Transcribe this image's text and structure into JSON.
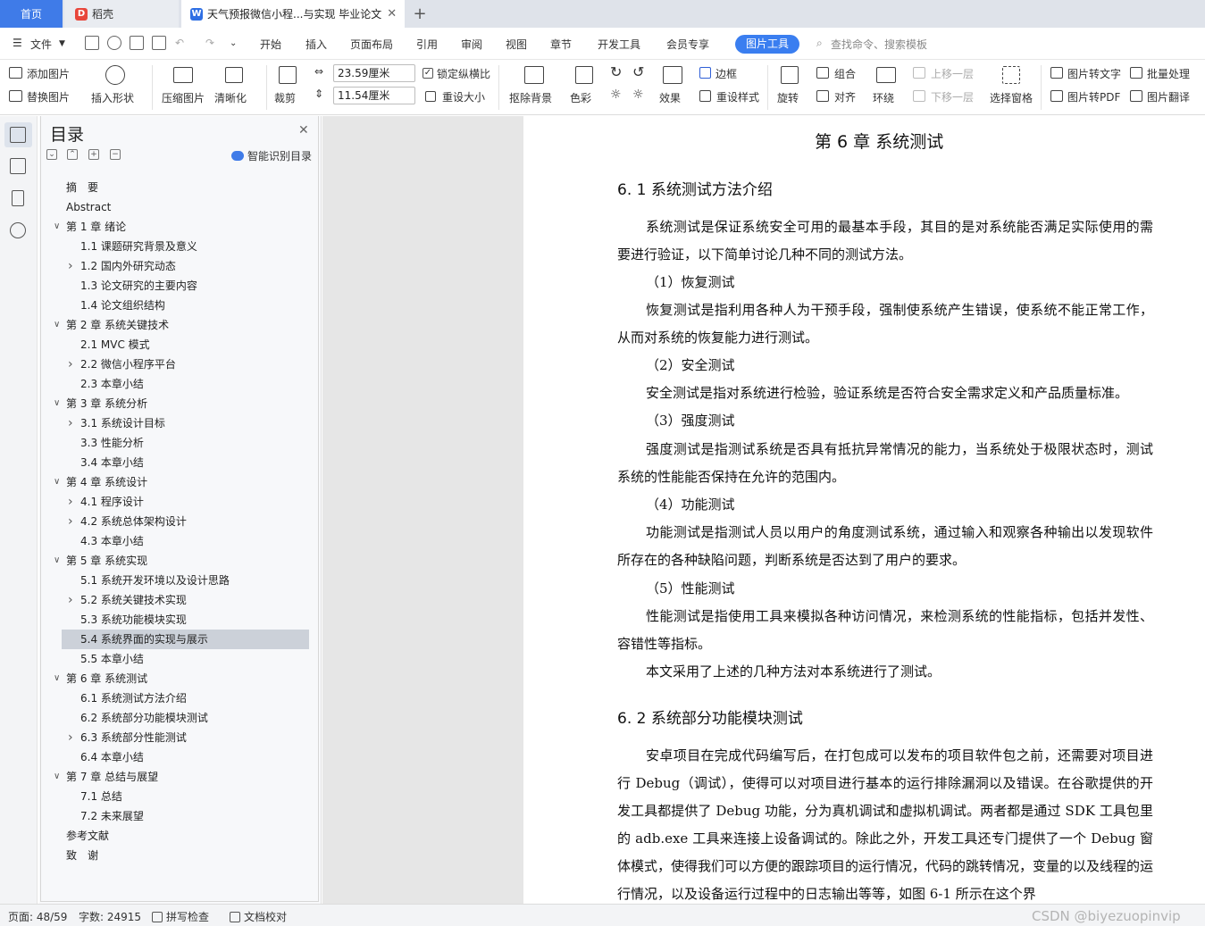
{
  "tabs": {
    "home": "首页",
    "daoke": "稻壳",
    "doc_title": "天气预报微信小程...与实现 毕业论文",
    "plus": "+"
  },
  "menu": {
    "file": "文件",
    "items": [
      "开始",
      "插入",
      "页面布局",
      "引用",
      "审阅",
      "视图",
      "章节",
      "开发工具",
      "会员专享"
    ],
    "active": "图片工具",
    "search": "查找命令、搜索模板"
  },
  "ribbon": {
    "add_image": "添加图片",
    "replace_image": "替换图片",
    "insert_shape": "插入形状",
    "compress": "压缩图片",
    "sharpen": "清晰化",
    "crop": "裁剪",
    "width": "23.59厘米",
    "height": "11.54厘米",
    "lock_ratio": "锁定纵横比",
    "reset_size": "重设大小",
    "remove_bg": "抠除背景",
    "color": "色彩",
    "effects": "效果",
    "border": "边框",
    "reset_style": "重设样式",
    "rotate": "旋转",
    "group": "组合",
    "align": "对齐",
    "wrap": "环绕",
    "bring_forward": "上移一层",
    "send_backward": "下移一层",
    "select_pane": "选择窗格",
    "img_to_text": "图片转文字",
    "batch": "批量处理",
    "img_to_pdf": "图片转PDF",
    "img_translate": "图片翻译"
  },
  "toc": {
    "title": "目录",
    "smart": "智能识别目录",
    "items": [
      {
        "label": "摘　要",
        "level": 0,
        "caret": ""
      },
      {
        "label": "Abstract",
        "level": 0,
        "caret": ""
      },
      {
        "label": "第 1 章  绪论",
        "level": 0,
        "caret": "v"
      },
      {
        "label": "1.1 课题研究背景及意义",
        "level": 1,
        "caret": ""
      },
      {
        "label": "1.2 国内外研究动态",
        "level": 1,
        "caret": ">"
      },
      {
        "label": "1.3 论文研究的主要内容",
        "level": 1,
        "caret": ""
      },
      {
        "label": "1.4 论文组织结构",
        "level": 1,
        "caret": ""
      },
      {
        "label": "第 2 章  系统关键技术",
        "level": 0,
        "caret": "v"
      },
      {
        "label": "2.1 MVC 模式",
        "level": 1,
        "caret": ""
      },
      {
        "label": "2.2  微信小程序平台",
        "level": 1,
        "caret": ">"
      },
      {
        "label": "2.3 本章小结",
        "level": 1,
        "caret": ""
      },
      {
        "label": "第 3 章  系统分析",
        "level": 0,
        "caret": "v"
      },
      {
        "label": "3.1 系统设计目标",
        "level": 1,
        "caret": ">"
      },
      {
        "label": "3.3 性能分析",
        "level": 1,
        "caret": ""
      },
      {
        "label": "3.4 本章小结",
        "level": 1,
        "caret": ""
      },
      {
        "label": "第 4 章  系统设计",
        "level": 0,
        "caret": "v"
      },
      {
        "label": "4.1 程序设计",
        "level": 1,
        "caret": ">"
      },
      {
        "label": "4.2 系统总体架构设计",
        "level": 1,
        "caret": ">"
      },
      {
        "label": "4.3 本章小结",
        "level": 1,
        "caret": ""
      },
      {
        "label": "第 5 章  系统实现",
        "level": 0,
        "caret": "v"
      },
      {
        "label": "5.1 系统开发环境以及设计思路",
        "level": 1,
        "caret": ""
      },
      {
        "label": "5.2 系统关键技术实现",
        "level": 1,
        "caret": ">"
      },
      {
        "label": "5.3 系统功能模块实现",
        "level": 1,
        "caret": ""
      },
      {
        "label": "5.4 系统界面的实现与展示",
        "level": 1,
        "caret": "",
        "selected": true
      },
      {
        "label": "5.5 本章小结",
        "level": 1,
        "caret": ""
      },
      {
        "label": "第 6 章  系统测试",
        "level": 0,
        "caret": "v"
      },
      {
        "label": "6.1 系统测试方法介绍",
        "level": 1,
        "caret": ""
      },
      {
        "label": "6.2 系统部分功能模块测试",
        "level": 1,
        "caret": ""
      },
      {
        "label": "6.3 系统部分性能测试",
        "level": 1,
        "caret": ">"
      },
      {
        "label": "6.4 本章小结",
        "level": 1,
        "caret": ""
      },
      {
        "label": "第 7 章  总结与展望",
        "level": 0,
        "caret": "v"
      },
      {
        "label": "7.1 总结",
        "level": 1,
        "caret": ""
      },
      {
        "label": "7.2 未来展望",
        "level": 1,
        "caret": ""
      },
      {
        "label": "参考文献",
        "level": 0,
        "caret": ""
      },
      {
        "label": "致　谢",
        "level": 0,
        "caret": ""
      }
    ]
  },
  "document": {
    "chapter_title": "第 6 章  系统测试",
    "section1_title": "6. 1 系统测试方法介绍",
    "p1": "系统测试是保证系统安全可用的最基本手段，其目的是对系统能否满足实际使用的需要进行验证，以下简单讨论几种不同的测试方法。",
    "s1": "（1）恢复测试",
    "p2": "恢复测试是指利用各种人为干预手段，强制使系统产生错误，使系统不能正常工作，从而对系统的恢复能力进行测试。",
    "s2": "（2）安全测试",
    "p3": "安全测试是指对系统进行检验，验证系统是否符合安全需求定义和产品质量标准。",
    "s3": "（3）强度测试",
    "p4": "强度测试是指测试系统是否具有抵抗异常情况的能力，当系统处于极限状态时，测试系统的性能能否保持在允许的范围内。",
    "s4": "（4）功能测试",
    "p5": "功能测试是指测试人员以用户的角度测试系统，通过输入和观察各种输出以发现软件所存在的各种缺陷问题，判断系统是否达到了用户的要求。",
    "s5": "（5）性能测试",
    "p6": "性能测试是指使用工具来模拟各种访问情况，来检测系统的性能指标，包括并发性、容错性等指标。",
    "p7": "本文采用了上述的几种方法对本系统进行了测试。",
    "section2_title": "6. 2 系统部分功能模块测试",
    "p8": "安卓项目在完成代码编写后，在打包成可以发布的项目软件包之前，还需要对项目进行 Debug（调试），使得可以对项目进行基本的运行排除漏洞以及错误。在谷歌提供的开发工具都提供了 Debug 功能，分为真机调试和虚拟机调试。两者都是通过 SDK 工具包里的 adb.exe 工具来连接上设备调试的。除此之外，开发工具还专门提供了一个 Debug 窗体模式，使得我们可以方便的跟踪项目的运行情况，代码的跳转情况，变量的以及线程的运行情况，以及设备运行过程中的日志输出等等，如图 6-1 所示在这个界"
  },
  "status": {
    "page": "页面: 48/59",
    "words": "字数: 24915",
    "spell": "拼写检查",
    "proof": "文档校对",
    "watermark": "CSDN @biyezuopinvip"
  },
  "colors": {
    "accent": "#3a7ef0",
    "toc_selected": "#ccd1d9"
  }
}
